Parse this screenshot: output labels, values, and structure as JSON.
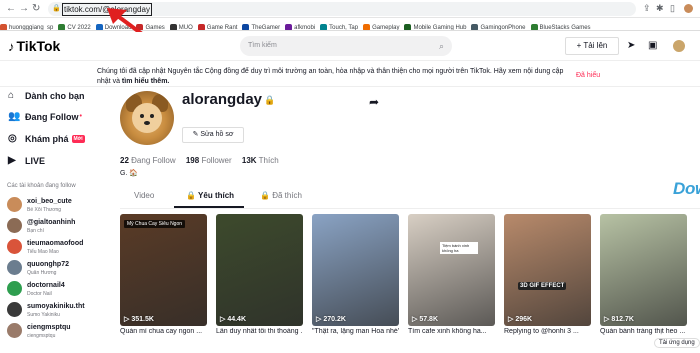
{
  "browser": {
    "url": "tiktok.com/@alorangday",
    "bookmarks": [
      "huongggiang_sp",
      "CV 2022",
      "Download",
      "Games",
      "MUO",
      "Game Rant",
      "TheGamer",
      "afkmobi",
      "Touch, Tap",
      "Gameplay",
      "Mobile Gaming Hub",
      "GamingonPhone",
      "BlueStacks Games"
    ],
    "bookmark_colors": [
      "#d35230",
      "#2e7d32",
      "#1565c0",
      "#c62828",
      "#333333",
      "#c62828",
      "#0d47a1",
      "#6a1b9a",
      "#00838f",
      "#ef6c00",
      "#1b5e20",
      "#455a64",
      "#2e7d32"
    ]
  },
  "header": {
    "logo": "TikTok",
    "search_placeholder": "Tìm kiếm",
    "upload_label": "Tải lên"
  },
  "notice": {
    "text": "Chúng tôi đã cập nhật Nguyên tắc Cộng đồng để duy trì môi trường an toàn, hòa nhập và thân thiện cho mọi người trên TikTok. Hãy xem nội dung cập nhật và",
    "link": "tìm hiểu thêm.",
    "dismiss": "Đã hiểu"
  },
  "sidebar": {
    "items": [
      {
        "label": "Dành cho bạn",
        "icon": "home-icon"
      },
      {
        "label": "Đang Follow",
        "icon": "following-icon"
      },
      {
        "label": "Khám phá",
        "icon": "compass-icon",
        "badge": "Mới"
      },
      {
        "label": "LIVE",
        "icon": "live-icon"
      }
    ],
    "section_title": "Các tài khoản đang follow",
    "accounts": [
      {
        "name": "xoi_beo_cute",
        "sub": "Bé Xôi Thương",
        "color": "#c98c5a"
      },
      {
        "name": "@gialtoanhinh",
        "sub": "Bạn chí",
        "color": "#8b6b55"
      },
      {
        "name": "tieumaomaofood",
        "sub": "Tiểu Mao Mao",
        "color": "#d9543a"
      },
      {
        "name": "quuonghp72",
        "sub": "Quân Hương",
        "color": "#6b7d8f"
      },
      {
        "name": "doctornail4",
        "sub": "Doctor Nail",
        "color": "#2e9e4f"
      },
      {
        "name": "sumoyakiniku.tht",
        "sub": "Sumo Yakiniku",
        "color": "#3a3a3a"
      },
      {
        "name": "ciengmsptqu",
        "sub": "ciengmsptqu",
        "color": "#9a7b6a"
      }
    ]
  },
  "profile": {
    "username": "alorangday",
    "edit_label": "Sửa hồ sơ",
    "following_count": "22",
    "following_label": "Đang Follow",
    "follower_count": "198",
    "follower_label": "Follower",
    "likes_count": "13K",
    "likes_label": "Thích",
    "bio": "G. 🏠"
  },
  "tabs": [
    "Video",
    "Yêu thích",
    "Đã thích"
  ],
  "videos": [
    {
      "views": "351.5K",
      "caption": "Quán mì chua cay ngon ...",
      "tag": "Mỳ Chua Cay Siêu Ngon",
      "bg": "#5a3b26"
    },
    {
      "views": "44.4K",
      "caption": "Lần duy nhất tôi thi thoảng ...",
      "tag": "",
      "bg": "#3d4a2c"
    },
    {
      "views": "270.2K",
      "caption": "\"Thật ra, lặng man Hoa nhé\"",
      "tag": "",
      "bg": "#8aa3c4"
    },
    {
      "views": "57.8K",
      "caption": "Tìm cafe xinh không ha...",
      "tag": "Tiệm bánh xinh không ha",
      "bg": "#d8cfc4"
    },
    {
      "views": "296K",
      "caption": "Replying to @honhi 3 ...",
      "tag": "3D GIF EFFECT",
      "bg": "#b88a6b"
    },
    {
      "views": "812.7K",
      "caption": "Quán bánh tráng thịt heo ...",
      "tag": "",
      "bg": "#b7c2a4"
    }
  ],
  "watermark": "Download.com.vn",
  "watermark_dot_colors": [
    "#e84b5d",
    "#f7b733",
    "#47b972",
    "#2f9bd8",
    "#9b59b6",
    "#f39c12"
  ],
  "get_app": "Tải ứng dụng"
}
